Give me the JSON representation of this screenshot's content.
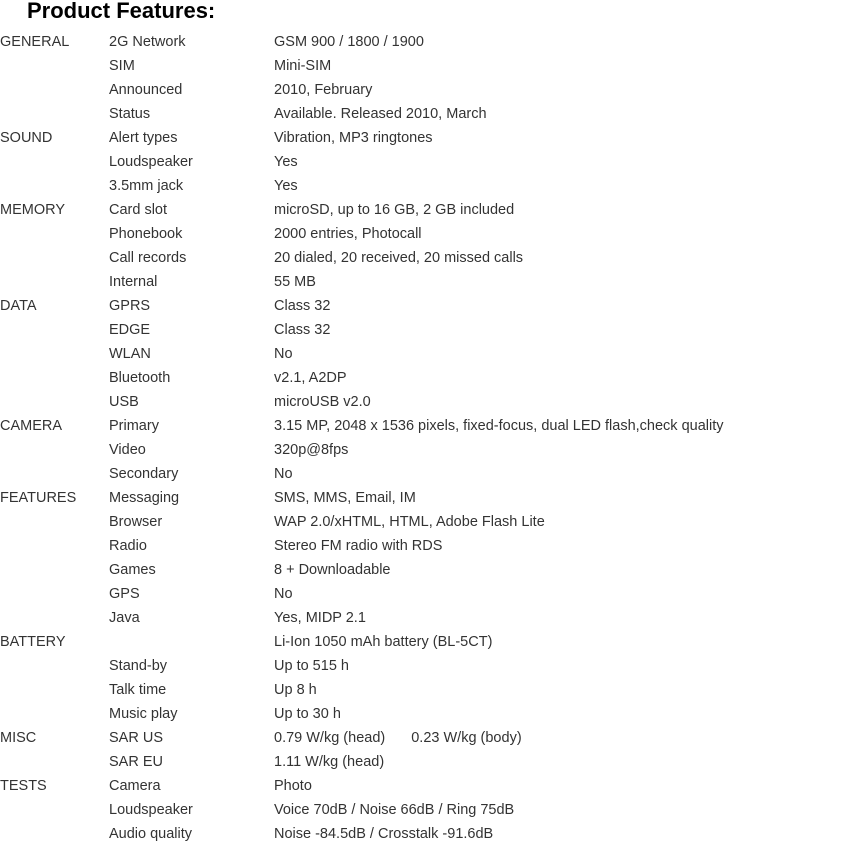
{
  "page": {
    "title": "Product Features:",
    "text_color": "#333333",
    "title_color": "#000000",
    "background": "#ffffff"
  },
  "table": {
    "rows": [
      {
        "category": "GENERAL",
        "feature": "2G Network",
        "value": "GSM 900 / 1800 / 1900"
      },
      {
        "category": "",
        "feature": "SIM",
        "value": "Mini-SIM"
      },
      {
        "category": "",
        "feature": "Announced",
        "value": "2010, February"
      },
      {
        "category": "",
        "feature": "Status",
        "value": "Available. Released 2010, March"
      },
      {
        "category": "SOUND",
        "feature": "Alert types",
        "value": "Vibration, MP3 ringtones"
      },
      {
        "category": "",
        "feature": "Loudspeaker",
        "value": "Yes"
      },
      {
        "category": "",
        "feature": "3.5mm jack",
        "value": "Yes"
      },
      {
        "category": "MEMORY",
        "feature": "Card slot",
        "value": "microSD, up to 16 GB, 2 GB included"
      },
      {
        "category": "",
        "feature": "Phonebook",
        "value": "2000 entries, Photocall"
      },
      {
        "category": "",
        "feature": "Call records",
        "value": "20 dialed, 20 received, 20 missed calls"
      },
      {
        "category": "",
        "feature": "Internal",
        "value": "55 MB"
      },
      {
        "category": "DATA",
        "feature": "GPRS",
        "value": "Class 32"
      },
      {
        "category": "",
        "feature": "EDGE",
        "value": "Class 32"
      },
      {
        "category": "",
        "feature": "WLAN",
        "value": "No"
      },
      {
        "category": "",
        "feature": "Bluetooth",
        "value": "v2.1, A2DP"
      },
      {
        "category": "",
        "feature": "USB",
        "value": "microUSB v2.0"
      },
      {
        "category": "CAMERA",
        "feature": "Primary",
        "value": "3.15 MP, 2048 x 1536 pixels, fixed-focus, dual LED flash,check quality",
        "wrap": true
      },
      {
        "category": "",
        "feature": "Video",
        "value": "320p@8fps"
      },
      {
        "category": "",
        "feature": "Secondary",
        "value": "No"
      },
      {
        "category": "FEATURES",
        "feature": "Messaging",
        "value": "SMS, MMS, Email, IM"
      },
      {
        "category": "",
        "feature": "Browser",
        "value": "WAP 2.0/xHTML, HTML, Adobe Flash Lite"
      },
      {
        "category": "",
        "feature": "Radio",
        "value": "Stereo FM radio with RDS"
      },
      {
        "category": "",
        "feature": "Games",
        "value": "8 + Downloadable"
      },
      {
        "category": "",
        "feature": "GPS",
        "value": "No"
      },
      {
        "category": "",
        "feature": "Java",
        "value": "Yes, MIDP 2.1"
      },
      {
        "category": "BATTERY",
        "feature": "",
        "value": "Li-Ion 1050 mAh battery (BL-5CT)"
      },
      {
        "category": "",
        "feature": "Stand-by",
        "value": "Up to 515 h"
      },
      {
        "category": "",
        "feature": "Talk time",
        "value": "Up 8 h"
      },
      {
        "category": "",
        "feature": "Music play",
        "value": "Up to 30 h"
      },
      {
        "category": "MISC",
        "feature": "SAR US",
        "value": "0.79 W/kg (head)",
        "value_2": "0.23 W/kg (body)"
      },
      {
        "category": "",
        "feature": "SAR EU",
        "value": "1.11 W/kg (head)"
      },
      {
        "category": "TESTS",
        "feature": "Camera",
        "value": "Photo"
      },
      {
        "category": "",
        "feature": "Loudspeaker",
        "value": "Voice 70dB / Noise 66dB / Ring 75dB"
      },
      {
        "category": "",
        "feature": "Audio quality",
        "value": "Noise -84.5dB / Crosstalk -91.6dB"
      }
    ]
  }
}
